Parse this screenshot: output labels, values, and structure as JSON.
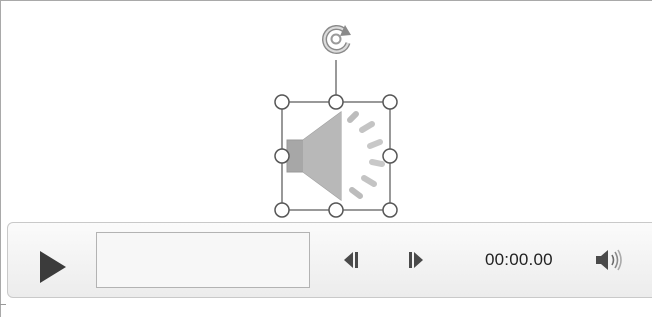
{
  "player": {
    "time": "00:00.00",
    "progress_fraction": 0
  },
  "icons": {
    "rotate": "rotate-handle-icon",
    "speaker": "speaker-icon",
    "play": "play-icon",
    "step_back": "step-back-icon",
    "step_forward": "step-forward-icon",
    "volume": "volume-icon"
  },
  "colors": {
    "icon_dark": "#3b3b3b",
    "icon_gray": "#999999",
    "handle_stroke": "#555555"
  }
}
